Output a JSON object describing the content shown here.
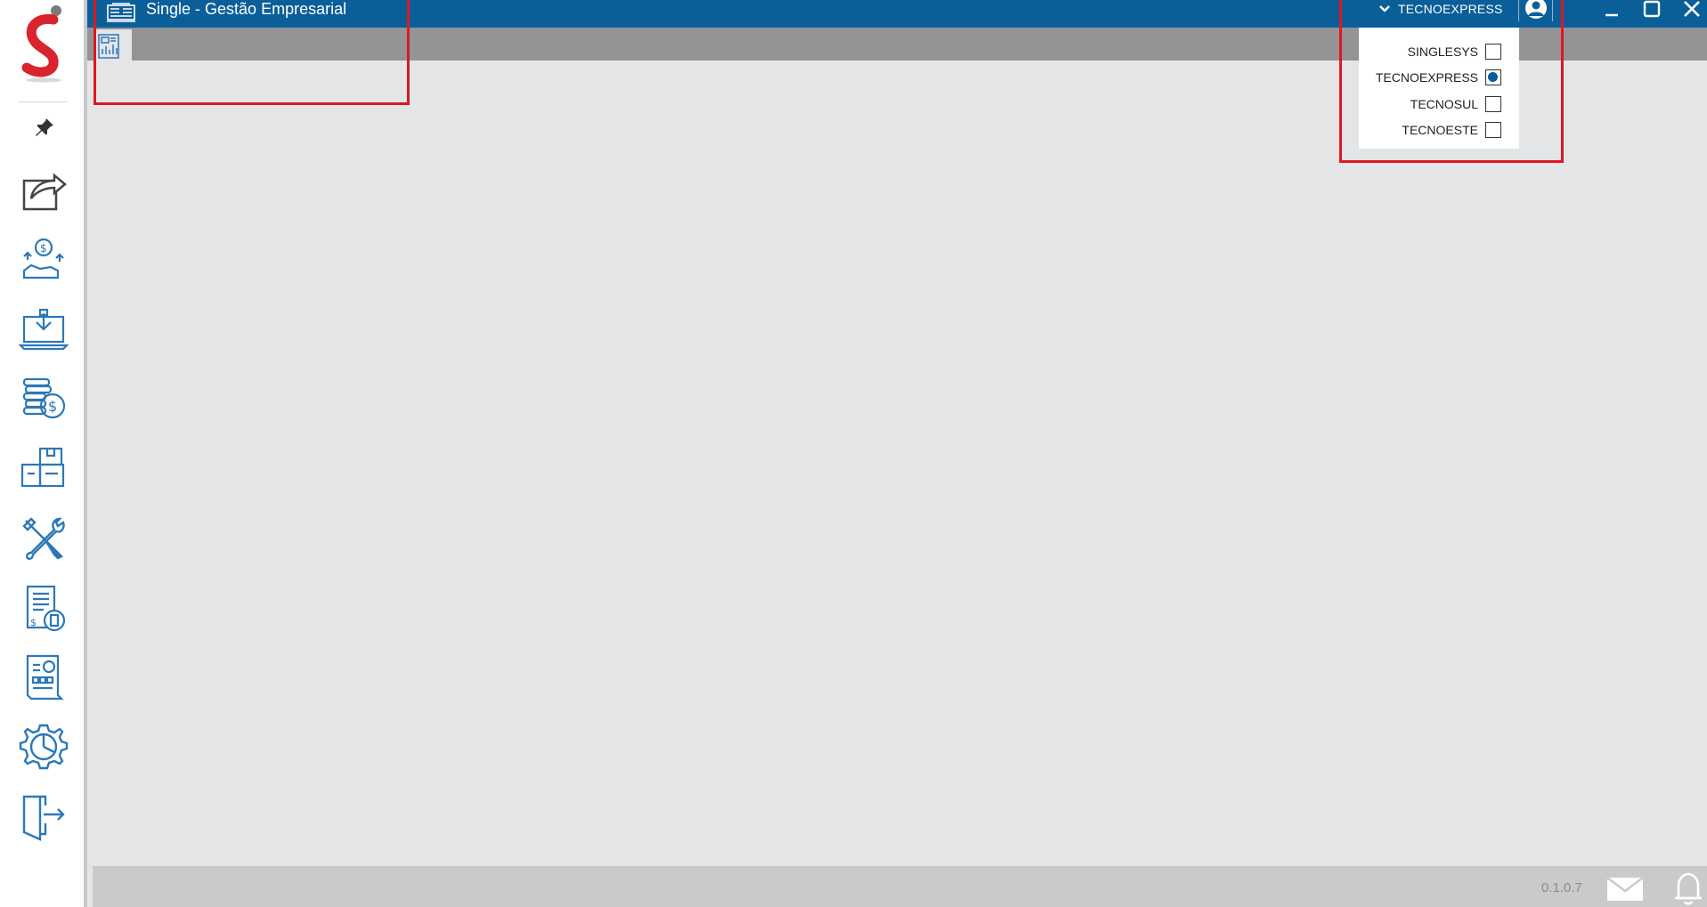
{
  "app": {
    "title": "Single - Gestão Empresarial",
    "accent_color": "#0a5f99",
    "logo_icon": "single-s-logo"
  },
  "sidebar": {
    "items": [
      {
        "icon": "pin-icon"
      },
      {
        "icon": "share-export-icon"
      },
      {
        "icon": "sales-money-hand-icon"
      },
      {
        "icon": "laptop-package-icon"
      },
      {
        "icon": "coins-dollar-icon"
      },
      {
        "icon": "warehouse-boxes-icon"
      },
      {
        "icon": "tools-wrench-screwdriver-icon"
      },
      {
        "icon": "invoice-receipt-icon"
      },
      {
        "icon": "report-document-icon"
      },
      {
        "icon": "gear-chart-icon"
      },
      {
        "icon": "exit-door-icon"
      }
    ]
  },
  "header": {
    "selected_company": "TECNOEXPRESS",
    "window_controls": [
      "minimize-icon",
      "maximize-icon",
      "close-icon"
    ]
  },
  "company_menu": {
    "options": [
      {
        "label": "SINGLESYS",
        "checked": false
      },
      {
        "label": "TECNOEXPRESS",
        "checked": true
      },
      {
        "label": "TECNOSUL",
        "checked": false
      },
      {
        "label": "TECNOESTE",
        "checked": false
      }
    ]
  },
  "statusbar": {
    "version": "0.1.0.7"
  }
}
